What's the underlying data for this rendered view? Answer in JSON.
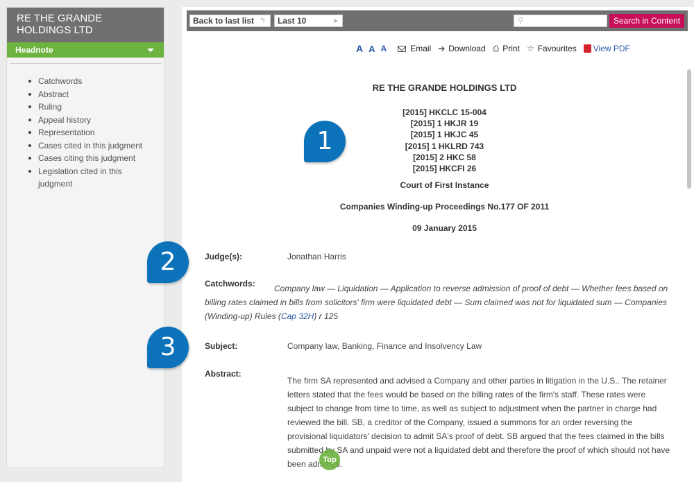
{
  "sidebar": {
    "title": "RE THE GRANDE HOLDINGS LTD",
    "headnote_label": "Headnote",
    "items": [
      {
        "label": "Catchwords"
      },
      {
        "label": "Abstract"
      },
      {
        "label": "Ruling"
      },
      {
        "label": "Appeal history"
      },
      {
        "label": "Representation"
      },
      {
        "label": "Cases cited in this judgment"
      },
      {
        "label": "Cases citing this judgment"
      },
      {
        "label": "Legislation cited in this judgment"
      }
    ]
  },
  "toolbar": {
    "back_label": "Back to last list",
    "back_symbol": "↰",
    "last_label": "Last 10",
    "last_symbol": "▸",
    "search_placeholder": "",
    "search_button": "Search in Content"
  },
  "actions": {
    "font_large": "A",
    "font_medium": "A",
    "font_small": "A",
    "email": "Email",
    "download": "Download",
    "print": "Print",
    "favourites": "Favourites",
    "view_pdf": "View PDF"
  },
  "document": {
    "title": "RE THE GRANDE HOLDINGS LTD",
    "citations": [
      "[2015] HKCLC 15-004",
      "[2015] 1 HKJR 19",
      "[2015] 1 HKJC 45",
      "[2015] 1 HKLRD 743",
      "[2015] 2 HKC 58",
      "[2015] HKCFI 26"
    ],
    "court": "Court of First Instance",
    "proceedings": "Companies Winding-up Proceedings No.177 OF 2011",
    "date": "09 January 2015",
    "judge_label": "Judge(s):",
    "judge": "Jonathan Harris",
    "catchwords_label": "Catchwords:",
    "catchwords_text": "Company law — Liquidation — Application to reverse admission of proof of debt — Whether fees based on billing rates claimed in bills from solicitors' firm were liquidated debt — Sum claimed was not for liquidated sum — Companies (Winding-up) Rules (",
    "catchwords_link": "Cap 32H",
    "catchwords_suffix": ") r 125",
    "subject_label": "Subject:",
    "subject": "Company law, Banking, Finance and Insolvency Law",
    "abstract_label": "Abstract:",
    "abstract": "The firm SA represented and advised a Company and other parties in litigation in the U.S.. The retainer letters stated that the fees would be based on the billing rates of the firm's staff. These rates were subject to change from time to time, as well as subject to adjustment when the partner in charge had reviewed the bill. SB, a creditor of the Company, issued a summons for an order reversing the provisional liquidators' decision to admit SA's proof of debt. SB argued that the fees claimed in the bills submitted by SA and unpaid were not a liquidated debt and therefore the proof of which should not have been admitted."
  },
  "badges": [
    "1",
    "2",
    "3"
  ],
  "top_button": "Top",
  "colors": {
    "header_gray": "#707070",
    "headnote_green": "#6cb33f",
    "search_magenta": "#c8105a",
    "badge_blue": "#0c72b9",
    "link_blue": "#2a5aa8"
  }
}
